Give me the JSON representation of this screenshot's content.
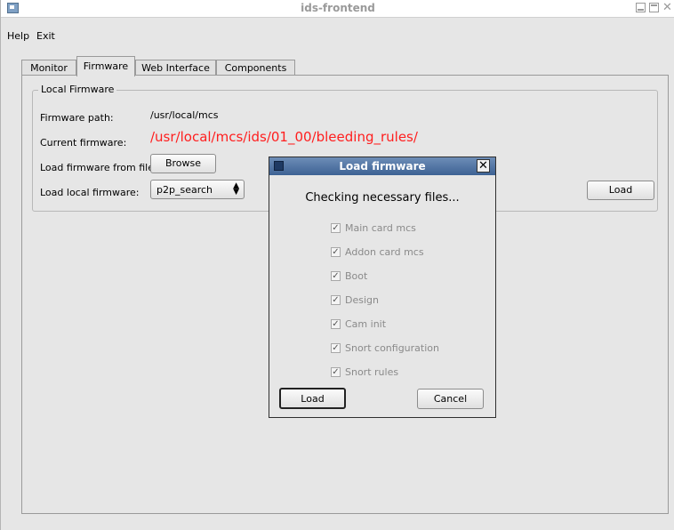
{
  "window": {
    "title": "ids-frontend"
  },
  "menu": [
    "Help",
    "Exit"
  ],
  "tabs": [
    "Monitor",
    "Firmware",
    "Web Interface",
    "Components"
  ],
  "active_tab": "Firmware",
  "local_firmware": {
    "group_title": "Local Firmware",
    "firmware_path_label": "Firmware path:",
    "firmware_path_value": "/usr/local/mcs",
    "current_firmware_label": "Current firmware:",
    "current_firmware_value": "/usr/local/mcs/ids/01_00/bleeding_rules/",
    "current_firmware_color": "#ff1e1e",
    "load_from_file_label": "Load firmware from file:",
    "browse_button": "Browse",
    "load_local_label": "Load local firmware:",
    "local_select_value": "p2p_search",
    "load_button": "Load"
  },
  "dialog": {
    "title": "Load firmware",
    "message": "Checking necessary files...",
    "checks": [
      {
        "label": "Main card mcs",
        "checked": true
      },
      {
        "label": "Addon card mcs",
        "checked": true
      },
      {
        "label": "Boot",
        "checked": true
      },
      {
        "label": "Design",
        "checked": true
      },
      {
        "label": "Cam init",
        "checked": true
      },
      {
        "label": "Snort configuration",
        "checked": true
      },
      {
        "label": "Snort rules",
        "checked": true
      }
    ],
    "load_button": "Load",
    "cancel_button": "Cancel",
    "titlebar_color": "#3d6294"
  }
}
